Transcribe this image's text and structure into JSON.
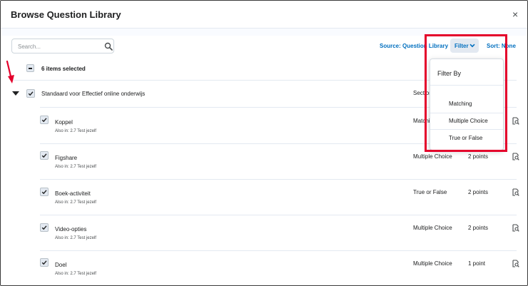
{
  "dialog": {
    "title": "Browse Question Library",
    "close_glyph": "×"
  },
  "toolbar": {
    "search_placeholder": "Search...",
    "source_label": "Source: Question Library",
    "filter_label": "Filter",
    "sort_label": "Sort: None"
  },
  "selection": {
    "text": "6 items selected"
  },
  "section": {
    "title": "Standaard voor Effectief online onderwijs",
    "type": "Section"
  },
  "questions": [
    {
      "name": "Koppel",
      "also_in": "Also in: 2.7 Test jezelf",
      "type": "Matching",
      "points": ""
    },
    {
      "name": "Figshare",
      "also_in": "Also in: 2.7 Test jezelf",
      "type": "Multiple Choice",
      "points": "2 points"
    },
    {
      "name": "Boek-activiteit",
      "also_in": "Also in: 2.7 Test jezelf",
      "type": "True or False",
      "points": "2 points"
    },
    {
      "name": "Video-opties",
      "also_in": "Also in: 2.7 Test jezelf",
      "type": "Multiple Choice",
      "points": "2 points"
    },
    {
      "name": "Doel",
      "also_in": "Also in: 2.7 Test jezelf",
      "type": "Multiple Choice",
      "points": "1 point"
    }
  ],
  "filter_dropdown": {
    "title": "Filter By",
    "items": [
      "Matching",
      "Multiple Choice",
      "True or False"
    ]
  },
  "colors": {
    "accent": "#006fbf",
    "annotation": "#e4002b",
    "checkbox_bg": "#e3e9f1"
  },
  "icons": {
    "search": "search-icon",
    "chevron": "chevron-down-icon",
    "preview": "preview-icon",
    "check": "check-icon",
    "caret": "caret-down-icon"
  }
}
